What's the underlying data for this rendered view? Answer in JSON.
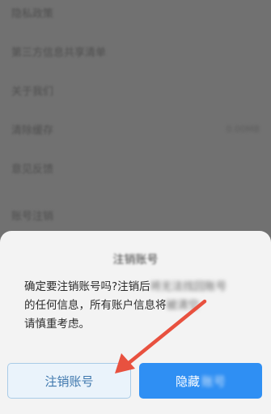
{
  "settings": {
    "items": [
      {
        "label": "隐私政策"
      },
      {
        "label": "第三方信息共享清单"
      },
      {
        "label": "关于我们"
      },
      {
        "label": "清除缓存",
        "value": "0.00MB"
      },
      {
        "label": "意见反馈"
      },
      {
        "label": "账号注销"
      }
    ]
  },
  "dialog": {
    "title": "注销账号",
    "message": {
      "line1": "确定要注销账号吗?注销后",
      "line1_blur": "将无法找回账号",
      "line2": "的任何信息，所有账户信息将",
      "line2_blur": "被清空",
      "line3": "请慎重考虑。"
    },
    "buttons": {
      "deregister": "注销账号",
      "hide_prefix": "隐藏",
      "hide_blur": "账号"
    }
  },
  "colors": {
    "primary": "#2f8ff3",
    "annotation_arrow": "#e8513f",
    "overlay": "#717171"
  }
}
